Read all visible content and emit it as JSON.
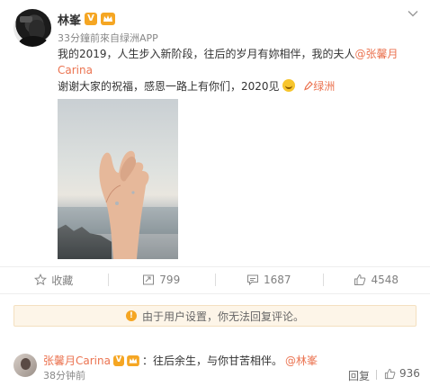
{
  "post": {
    "author": "林峯",
    "verified_badge": "V",
    "meta": "33分鐘前來自绿洲APP",
    "text_line1_before": "我的2019，人生步入新阶段，往后的岁月有妳相伴，我的夫人",
    "mention": "@张馨月Carina",
    "text_line2": "谢谢大家的祝福，感恩一路上有你们，2020见",
    "location": "绿洲",
    "photo_desc_icon": "hands-pinky-promise-photo"
  },
  "actions": {
    "favorite_label": "收藏",
    "repost_count": "799",
    "comment_count": "1687",
    "like_count": "4548"
  },
  "notice": {
    "icon": "!",
    "text": "由于用户设置，你无法回复评论。"
  },
  "comment": {
    "author": "张馨月Carina",
    "badge": "V",
    "text": "：往后余生，与你甘苦相伴。",
    "mention": "@林峯",
    "time": "38分钟前",
    "reply_label": "回复",
    "like_count": "936"
  },
  "colors": {
    "accent": "#eb7350",
    "badge": "#f5a623",
    "notice_bg": "#fdf5e8"
  }
}
